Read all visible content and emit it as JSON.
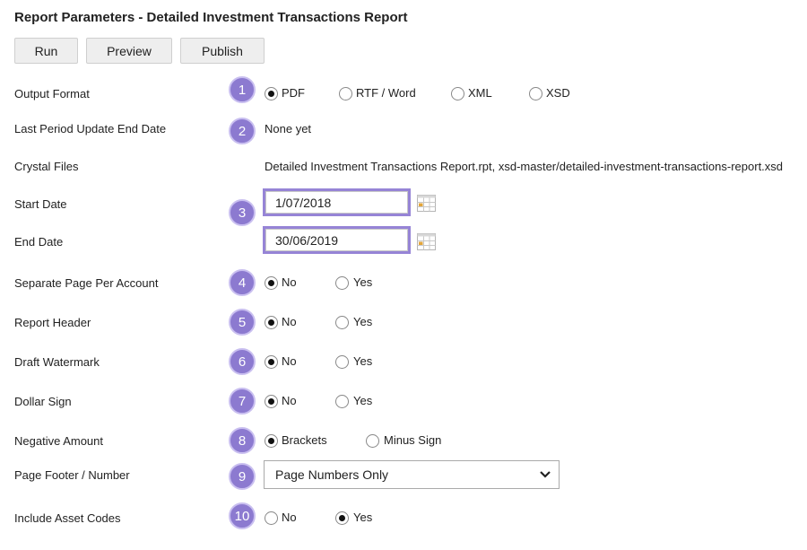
{
  "title": "Report Parameters - Detailed Investment Transactions Report",
  "toolbar": {
    "run_label": "Run",
    "preview_label": "Preview",
    "publish_label": "Publish"
  },
  "badges": [
    "1",
    "2",
    "3",
    "4",
    "5",
    "6",
    "7",
    "8",
    "9",
    "10"
  ],
  "fields": {
    "output_format": {
      "label": "Output Format",
      "options": [
        "PDF",
        "RTF / Word",
        "XML",
        "XSD"
      ],
      "selected": "PDF"
    },
    "last_period": {
      "label": "Last Period Update End Date",
      "value": "None yet"
    },
    "crystal_files": {
      "label": "Crystal Files",
      "value": "Detailed Investment Transactions Report.rpt, xsd-master/detailed-investment-transactions-report.xsd"
    },
    "start_date": {
      "label": "Start Date",
      "value": "1/07/2018"
    },
    "end_date": {
      "label": "End Date",
      "value": "30/06/2019"
    },
    "separate_page": {
      "label": "Separate Page Per Account",
      "options": [
        "No",
        "Yes"
      ],
      "selected": "No"
    },
    "report_header": {
      "label": "Report Header",
      "options": [
        "No",
        "Yes"
      ],
      "selected": "No"
    },
    "draft_watermark": {
      "label": "Draft Watermark",
      "options": [
        "No",
        "Yes"
      ],
      "selected": "No"
    },
    "dollar_sign": {
      "label": "Dollar Sign",
      "options": [
        "No",
        "Yes"
      ],
      "selected": "No"
    },
    "negative_amount": {
      "label": "Negative Amount",
      "options": [
        "Brackets",
        "Minus Sign"
      ],
      "selected": "Brackets"
    },
    "page_footer": {
      "label": "Page Footer / Number",
      "value": "Page Numbers Only"
    },
    "asset_codes": {
      "label": "Include Asset Codes",
      "options": [
        "No",
        "Yes"
      ],
      "selected": "Yes"
    }
  },
  "colors": {
    "badge": "#8c7ad0",
    "highlight_border": "#9684d6",
    "button_bg": "#eeeeee"
  }
}
